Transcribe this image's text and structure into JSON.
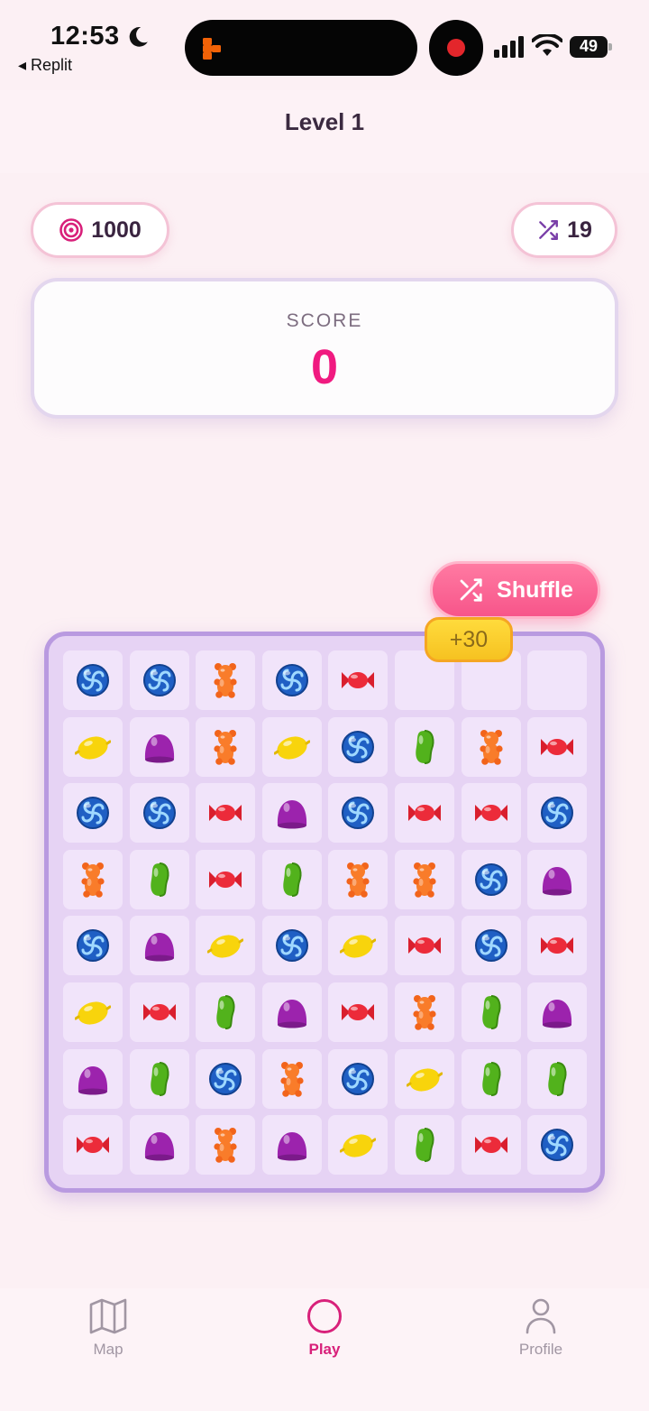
{
  "status_bar": {
    "time": "12:53",
    "back_app": "◂ Replit",
    "battery": "49"
  },
  "header": {
    "title": "Level 1"
  },
  "stats": {
    "target": "1000",
    "moves": "19"
  },
  "score": {
    "label": "SCORE",
    "value": "0"
  },
  "actions": {
    "shuffle_label": "Shuffle",
    "bonus_label": "+30"
  },
  "board": {
    "rows": [
      [
        "swirl",
        "swirl",
        "bear",
        "swirl",
        "wrapped",
        "empty",
        "empty",
        "empty"
      ],
      [
        "lemon",
        "gumdrop",
        "bear",
        "lemon",
        "swirl",
        "bean",
        "bear",
        "wrapped"
      ],
      [
        "swirl",
        "swirl",
        "wrapped",
        "gumdrop",
        "swirl",
        "wrapped",
        "wrapped",
        "swirl"
      ],
      [
        "bear",
        "bean",
        "wrapped",
        "bean",
        "bear",
        "bear",
        "swirl",
        "gumdrop"
      ],
      [
        "swirl",
        "gumdrop",
        "lemon",
        "swirl",
        "lemon",
        "wrapped",
        "swirl",
        "wrapped"
      ],
      [
        "lemon",
        "wrapped",
        "bean",
        "gumdrop",
        "wrapped",
        "bear",
        "bean",
        "gumdrop"
      ],
      [
        "gumdrop",
        "bean",
        "swirl",
        "bear",
        "swirl",
        "lemon",
        "bean",
        "bean"
      ],
      [
        "wrapped",
        "gumdrop",
        "bear",
        "gumdrop",
        "lemon",
        "bean",
        "wrapped",
        "swirl"
      ]
    ]
  },
  "nav": {
    "items": [
      {
        "label": "Map",
        "icon": "map-icon",
        "active": false
      },
      {
        "label": "Play",
        "icon": "play-circle-icon",
        "active": true
      },
      {
        "label": "Profile",
        "icon": "profile-icon",
        "active": false
      }
    ]
  },
  "colors": {
    "accent": "#f01a80",
    "board_border": "#b99ae0",
    "pill_border": "#f4c3d6",
    "shuffle": "#f7558a",
    "bonus": "#f6c221"
  }
}
